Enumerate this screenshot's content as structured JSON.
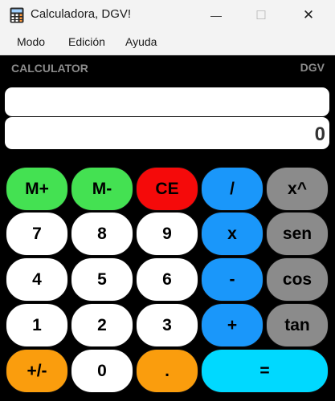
{
  "window": {
    "title": "Calculadora, DGV!",
    "minimize_glyph": "—",
    "maximize_glyph": "☐",
    "close_glyph": "✕"
  },
  "menu": [
    "Modo",
    "Edición",
    "Ayuda"
  ],
  "header": {
    "left": "CALCULATOR",
    "right": "DGV"
  },
  "display": {
    "expression": "",
    "value": "0"
  },
  "keys": {
    "m_plus": "M+",
    "m_minus": "M-",
    "ce": "CE",
    "divide": "/",
    "power": "x^",
    "seven": "7",
    "eight": "8",
    "nine": "9",
    "multiply": "x",
    "sen": "sen",
    "four": "4",
    "five": "5",
    "six": "6",
    "minus": "-",
    "cos": "cos",
    "one": "1",
    "two": "2",
    "three": "3",
    "plus": "+",
    "tan": "tan",
    "sign": "+/-",
    "zero": "0",
    "dot": ".",
    "equals": "="
  },
  "colors": {
    "memory": "#44e152",
    "clear": "#f50a0a",
    "operator": "#1a97fa",
    "function": "#8b8b8b",
    "digit": "#ffffff",
    "misc": "#fa9d0d",
    "equals": "#00d9ff",
    "background": "#000000",
    "header_text": "#8c8c8c"
  },
  "icons": {
    "app": "calculator-icon"
  }
}
